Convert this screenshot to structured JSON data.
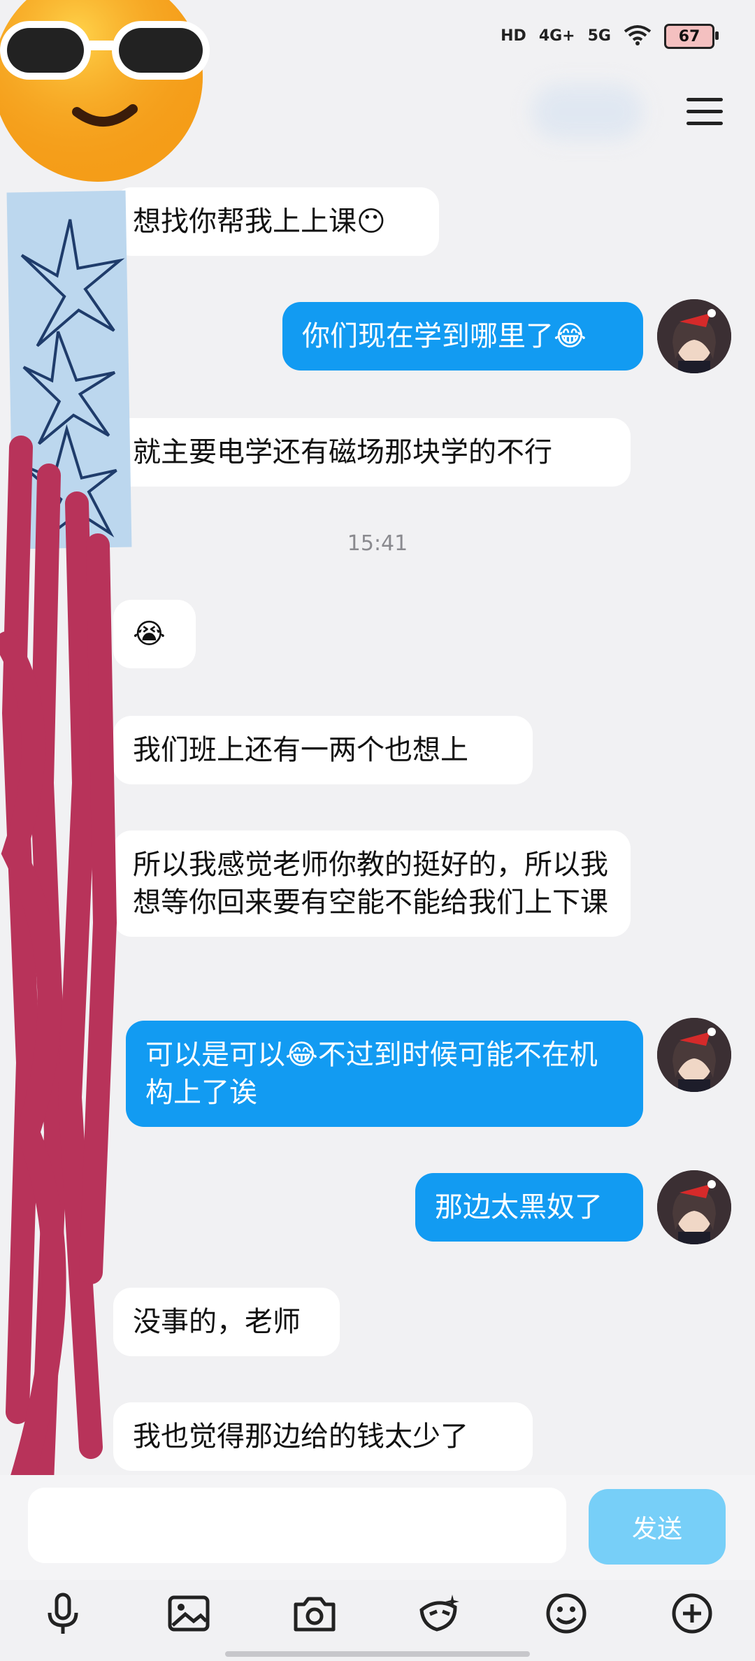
{
  "status_bar": {
    "hd": "HD",
    "net1": "4G+",
    "net2": "5G",
    "battery": "67"
  },
  "messages": [
    {
      "side": "in",
      "text": "想找你帮我上上课😶"
    },
    {
      "side": "out",
      "text": "你们现在学到哪里了😂"
    },
    {
      "side": "in",
      "text": "就主要电学还有磁场那块学的不行"
    },
    {
      "time": "15:41"
    },
    {
      "side": "in",
      "text": "😭"
    },
    {
      "side": "in",
      "text": "我们班上还有一两个也想上"
    },
    {
      "side": "in",
      "text": "所以我感觉老师你教的挺好的，所以我想等你回来要有空能不能给我们上下课"
    },
    {
      "side": "out",
      "text": "可以是可以😂不过到时候可能不在机构上了诶"
    },
    {
      "side": "out",
      "text": "那边太黑奴了"
    },
    {
      "side": "in",
      "text": "没事的，老师"
    },
    {
      "side": "in",
      "text": "我也觉得那边给的钱太少了"
    }
  ],
  "input": {
    "placeholder": ""
  },
  "send_button": {
    "label": "发送"
  },
  "colors": {
    "outgoing": "#129bf2",
    "incoming": "#ffffff",
    "background": "#f1f1f3"
  },
  "toolbar_icons": [
    "microphone-icon",
    "image-icon",
    "camera-icon",
    "sticker-icon",
    "emoji-icon",
    "plus-icon"
  ]
}
